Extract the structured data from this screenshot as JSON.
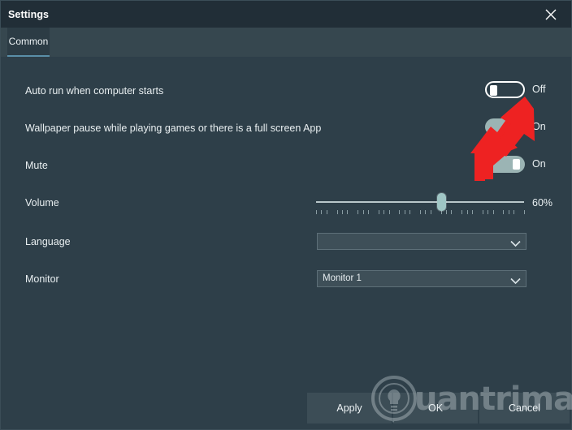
{
  "window": {
    "title": "Settings",
    "close_icon": "close-icon"
  },
  "tabs": [
    {
      "label": "Common",
      "active": true
    }
  ],
  "settings": {
    "rows": [
      {
        "label": "Auto run when computer starts",
        "control": "toggle",
        "state_label": "Off",
        "on": false
      },
      {
        "label": "Wallpaper pause while playing games or there is a full screen App",
        "control": "toggle",
        "state_label": "On",
        "on": true
      },
      {
        "label": "Mute",
        "control": "toggle",
        "state_label": "On",
        "on": true
      },
      {
        "label": "Volume",
        "control": "slider",
        "value_label": "60%",
        "value": 60,
        "min": 0,
        "max": 100
      },
      {
        "label": "Language",
        "control": "dropdown",
        "value": "",
        "arrow_icon": "chevron-down-icon"
      },
      {
        "label": "Monitor",
        "control": "dropdown",
        "value": "Monitor 1",
        "arrow_icon": "chevron-down-icon"
      }
    ]
  },
  "footer": {
    "apply_label": "Apply",
    "ok_label": "OK",
    "cancel_label": "Cancel"
  },
  "watermark": {
    "text": "uantrimang",
    "logo_icon": "lightbulb-circle-logo"
  },
  "annotation": {
    "type": "red-arrow",
    "color": "#ee2222",
    "points_to": "Auto run when computer starts toggle"
  },
  "colors": {
    "titlebar_bg": "#212e37",
    "tabstrip_bg": "#36474f",
    "content_bg": "#2e3f49",
    "tab_active_underline": "#5a8fa8",
    "toggle_on_bg": "#9bb4b4",
    "slider_thumb": "#9fc6c5",
    "button_bg": "#3c4d56",
    "text": "#e9eff1"
  }
}
